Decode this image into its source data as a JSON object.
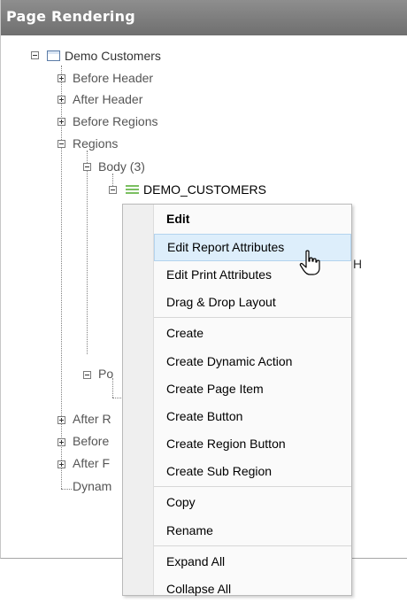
{
  "panel": {
    "title": "Page Rendering"
  },
  "tree": {
    "root": "Demo Customers",
    "before_header": "Before Header",
    "after_header": "After Header",
    "before_regions": "Before Regions",
    "regions": "Regions",
    "body": "Body (3)",
    "region_name": "DEMO_CUSTOMERS",
    "region_trailing": "H",
    "post_partial": "Po",
    "after_r_partial": "After R",
    "before_partial": "Before",
    "after_f_partial": "After F",
    "dynam_partial": "Dynam"
  },
  "context_menu": {
    "items": [
      "Edit",
      "Edit Report Attributes",
      "Edit Print Attributes",
      "Drag & Drop Layout",
      "Create",
      "Create Dynamic Action",
      "Create Page Item",
      "Create Button",
      "Create Region Button",
      "Create Sub Region",
      "Copy",
      "Rename",
      "Expand All",
      "Collapse All"
    ],
    "hovered_item": "Edit Report Attributes"
  },
  "colors": {
    "header_bg": "#7d7d7d",
    "hover_bg": "#ddeefb",
    "region_icon": "#7bbf61",
    "page_icon": "#5b7ca7"
  }
}
